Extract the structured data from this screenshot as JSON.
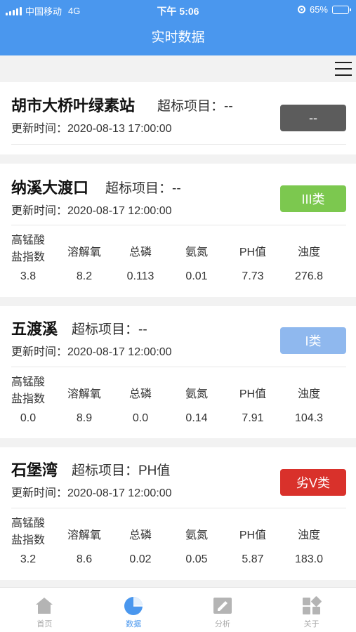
{
  "status": {
    "carrier": "中国移动",
    "network": "4G",
    "time": "下午 5:06",
    "battery": "65%",
    "battery_level": 0.65
  },
  "header": {
    "title": "实时数据"
  },
  "colors": {
    "accent": "#4a97ee",
    "badge_none": "#5c5c5c",
    "badge_class3": "#7cc84f",
    "badge_class1": "#8fb8ee",
    "badge_bad": "#d9312b"
  },
  "metric_labels": [
    "高锰酸\n盐指数",
    "溶解氧",
    "总磷",
    "氨氮",
    "PH值",
    "浊度"
  ],
  "stations": [
    {
      "name": "胡市大桥叶绿素站",
      "exceed_label": "超标项目：--",
      "updated": "更新时间：2020-08-13 17:00:00",
      "badge": "--",
      "metrics": []
    },
    {
      "name": "纳溪大渡口",
      "exceed_label": "超标项目：--",
      "updated": "更新时间：2020-08-17 12:00:00",
      "badge": "III类",
      "metrics": [
        "3.8",
        "8.2",
        "0.113",
        "0.01",
        "7.73",
        "276.8"
      ]
    },
    {
      "name": "五渡溪",
      "exceed_label": "超标项目：--",
      "updated": "更新时间：2020-08-17 12:00:00",
      "badge": "I类",
      "metrics": [
        "0.0",
        "8.9",
        "0.0",
        "0.14",
        "7.91",
        "104.3"
      ]
    },
    {
      "name": "石堡湾",
      "exceed_label": "超标项目：PH值",
      "updated": "更新时间：2020-08-17 12:00:00",
      "badge": "劣V类",
      "metrics": [
        "3.2",
        "8.6",
        "0.02",
        "0.05",
        "5.87",
        "183.0"
      ]
    }
  ],
  "tabs": [
    {
      "label": "首页",
      "icon": "home-icon"
    },
    {
      "label": "数据",
      "icon": "pie-chart-icon"
    },
    {
      "label": "分析",
      "icon": "edit-icon"
    },
    {
      "label": "关于",
      "icon": "grid-icon"
    }
  ]
}
